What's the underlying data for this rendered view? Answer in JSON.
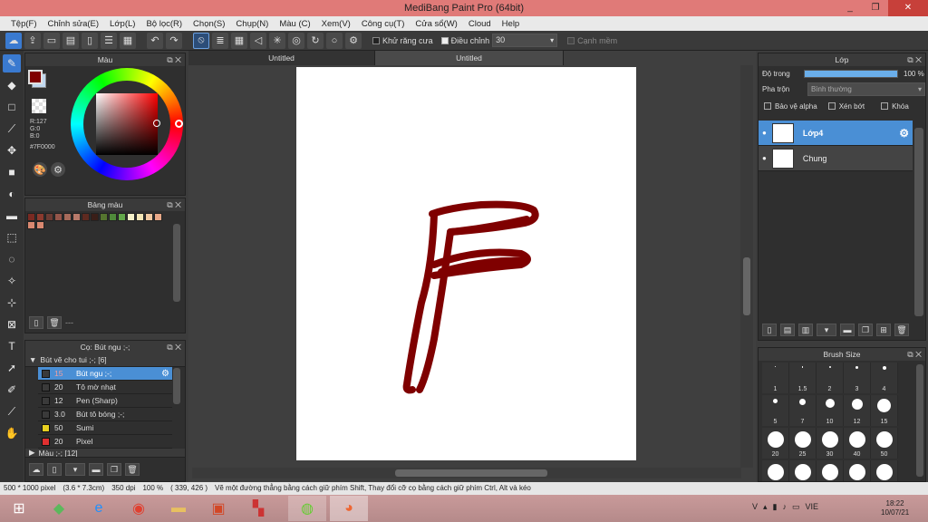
{
  "window": {
    "title": "MediBang Paint Pro (64bit)",
    "min": "_",
    "max": "❐",
    "close": "✕"
  },
  "menu": [
    "Tệp(F)",
    "Chỉnh sửa(E)",
    "Lớp(L)",
    "Bộ lọc(R)",
    "Chọn(S)",
    "Chụp(N)",
    "Màu (C)",
    "Xem(V)",
    "Công cụ(T)",
    "Cửa sổ(W)",
    "Cloud",
    "Help"
  ],
  "toolbar": {
    "antialias_label": "Khử răng cưa",
    "correction_label": "Điều chỉnh",
    "correction_value": "30",
    "soft_edge_label": "Cạnh mềm"
  },
  "color_panel": {
    "title": "Màu",
    "r": "R:127",
    "g": "G:0",
    "b": "B:0",
    "hex": "#7F0000",
    "primary": "#7f0000",
    "secondary": "#c0d8f0"
  },
  "palette_panel": {
    "title": "Bảng màu",
    "colors": [
      "#7a2a22",
      "#8b3a2e",
      "#6b3b33",
      "#94554a",
      "#a66a5a",
      "#b87a6a",
      "#5e2a20",
      "#3a1e18",
      "#55752f",
      "#4f8a3a",
      "#63a84a",
      "#f5f0c8",
      "#f3e5b5",
      "#f0c8a0",
      "#e8a888",
      "#d98870"
    ],
    "extra_color": "#d98870",
    "footer_text": "---"
  },
  "brush_panel": {
    "title": "Cọ: Bút ngu ;-;",
    "group": "Bút vẽ cho tui ;-; [6]",
    "items": [
      {
        "size": "15",
        "name": "Bút ngu ;-;",
        "color": "#3a3a3a"
      },
      {
        "size": "20",
        "name": "Tô mờ nhạt",
        "color": "#3a3a3a"
      },
      {
        "size": "12",
        "name": "Pen (Sharp)",
        "color": "#3a3a3a"
      },
      {
        "size": "3.0",
        "name": "Bút tô bóng ;-;",
        "color": "#3a3a3a"
      },
      {
        "size": "50",
        "name": "Sumi",
        "color": "#e8d020"
      },
      {
        "size": "20",
        "name": "Pixel",
        "color": "#e03030"
      }
    ],
    "next_group": "Màu ;-; [12]"
  },
  "tabs": [
    {
      "label": "Untitled"
    },
    {
      "label": "Untitled"
    }
  ],
  "layer_panel": {
    "title": "Lớp",
    "opacity_label": "Độ trong",
    "opacity_value": "100 %",
    "opacity": 1.0,
    "blend_label": "Pha trộn",
    "blend_value": "Bình thường",
    "protect_alpha": "Bảo vệ alpha",
    "clipping": "Xén bớt",
    "lock": "Khóa",
    "layers": [
      {
        "name": "Lớp4",
        "selected": true
      },
      {
        "name": "Chung",
        "selected": false
      }
    ]
  },
  "brush_size_panel": {
    "title": "Brush Size",
    "sizes": [
      "1",
      "1.5",
      "2",
      "3",
      "4",
      "5",
      "7",
      "10",
      "12",
      "15",
      "20",
      "25",
      "30",
      "40",
      "50",
      "",
      "",
      "",
      "",
      ""
    ]
  },
  "status": {
    "size": "500 * 1000 pixel",
    "dims": "(3.6 * 7.3cm)",
    "dpi": "350 dpi",
    "zoom": "100 %",
    "coords": "( 339, 426 )",
    "hint": "Vẽ một đường thẳng bằng cách giữ phím Shift, Thay đổi cỡ cọ bằng cách giữ phím Ctrl, Alt và kéo"
  },
  "taskbar": {
    "lang": "VIE",
    "time": "18:22",
    "date": "10/07/21"
  }
}
